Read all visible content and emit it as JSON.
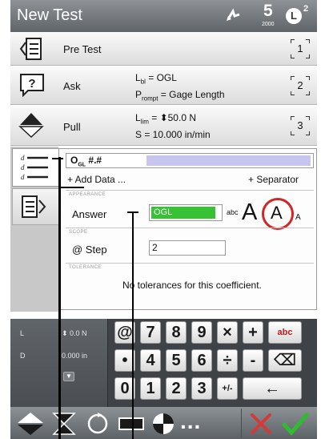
{
  "title_bar": {
    "title": "New Test",
    "step_count": "5",
    "step_sub": "2000",
    "clock_letter": "L",
    "clock_num": "2"
  },
  "steps": [
    {
      "label": "Pre Test",
      "detail_1": "",
      "detail_2": "",
      "num": "1",
      "icon": "pre-test-icon"
    },
    {
      "label": "Ask",
      "detail_1_main": "L",
      "detail_1_sub": "bl",
      "detail_1_rest": " = OGL",
      "detail_2_main": "P",
      "detail_2_sub": "rompt",
      "detail_2_rest": " = Gage Length",
      "num": "2",
      "icon": "ask-icon"
    },
    {
      "label": "Pull",
      "detail_1_main": "L",
      "detail_1_sub": "lim",
      "detail_1_rest": " = ⬍50.0 N",
      "detail_2_main": "S = 10.000 in/min",
      "num": "3",
      "icon": "pull-icon"
    }
  ],
  "edit_panel": {
    "name_main": "O",
    "name_sub": "GL",
    "name_rest": "  #.#",
    "add_data": "+ Add Data ...",
    "add_separator": "+ Separator",
    "appearance_hdr": "APPEARANCE",
    "answer_label": "Answer",
    "answer_value": "OGL",
    "abc_label": "abc",
    "font_large": "A",
    "font_medium": "A",
    "font_small": "A",
    "scope_hdr": "SCOPE",
    "step_label": "@ Step",
    "step_value": "2",
    "tolerance_hdr": "TOLERANCE",
    "tolerance_msg": "No tolerances for this coefficient."
  },
  "readout": {
    "l_label": "L",
    "l_value": "⬍ 0.0 N",
    "d_label": "D",
    "d_value": "0.000 in"
  },
  "keypad": {
    "row1": [
      "@",
      "7",
      "8",
      "9",
      "×",
      "+",
      "abc"
    ],
    "row2": [
      "•",
      "4",
      "5",
      "6",
      "÷",
      "-",
      "⌫"
    ],
    "row3": [
      "0",
      "1",
      "2",
      "3",
      "+/-",
      "←"
    ]
  },
  "toolbar": {
    "more_label": "...",
    "cancel_color": "#d23b3b",
    "ok_color": "#2ebd2e"
  },
  "colors": {
    "answer_green": "#37c135",
    "name_highlight": "#c8c6ee",
    "font_circle": "#d02626"
  }
}
